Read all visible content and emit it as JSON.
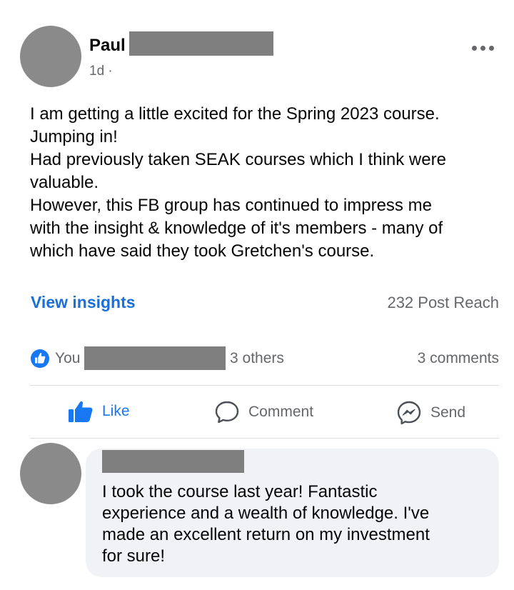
{
  "post": {
    "author_name": "Paul",
    "timestamp": "1d",
    "meta_separator": "·",
    "body_lines": [
      "I am getting a little excited for the Spring 2023 course.",
      "Jumping in!",
      "Had previously taken SEAK courses which I think were",
      "valuable.",
      "However, this FB group has continued to impress me",
      "with the insight & knowledge of it's members - many of",
      "which have said they took Gretchen's course."
    ],
    "view_insights_label": "View insights",
    "post_reach": "232 Post Reach"
  },
  "reactions": {
    "you_label": "You",
    "others_label": "3 others",
    "comments_label": "3 comments"
  },
  "actions": {
    "like": "Like",
    "comment": "Comment",
    "send": "Send"
  },
  "comment": {
    "lines": [
      "I took the course last year! Fantastic",
      "experience and a wealth of knowledge. I've",
      "made an excellent return on my investment",
      "for sure!"
    ]
  },
  "colors": {
    "link": "#1a6fd8",
    "like_blue": "#1877f2",
    "muted_text": "#65676b",
    "redaction": "#7f7f7f",
    "avatar": "#8a8a8a",
    "bubble": "#f0f2f5"
  },
  "icons": [
    "more-options-icon",
    "like-reaction-icon",
    "thumbs-up-icon",
    "comment-icon",
    "messenger-icon"
  ]
}
